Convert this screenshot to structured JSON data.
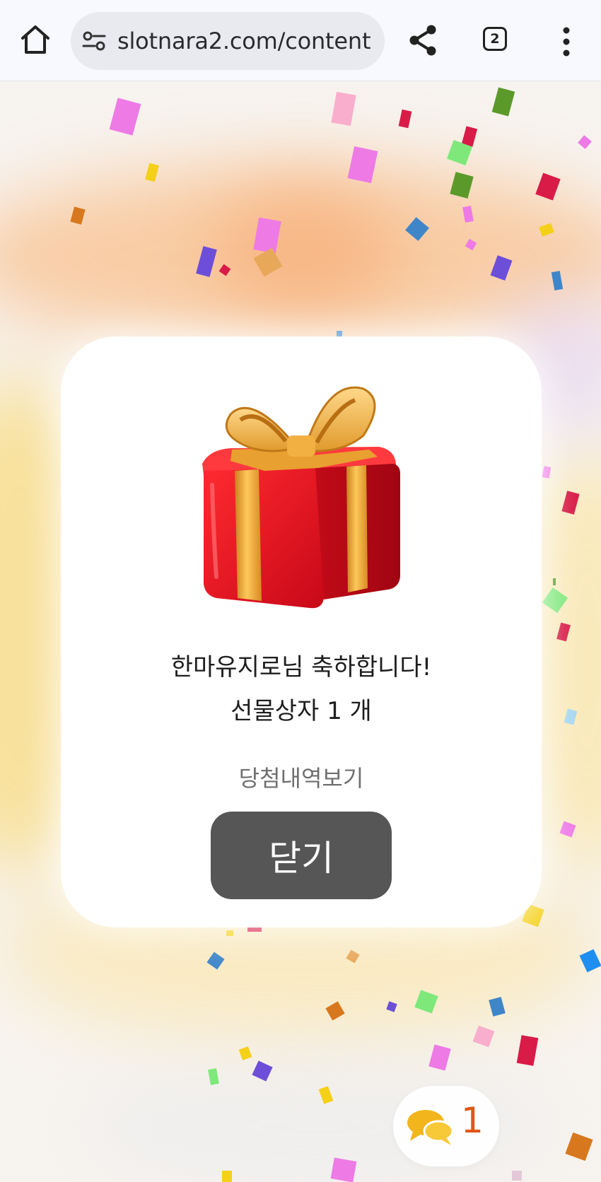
{
  "browser": {
    "url": "slotnara2.com/content",
    "tab_count": "2",
    "icons": [
      "home-icon",
      "site-info-icon",
      "share-icon",
      "tabs-icon",
      "menu-icon"
    ]
  },
  "popup": {
    "message_line1": "한마유지로님 축하합니다!",
    "message_line2": "선물상자 1 개",
    "history_link": "당첨내역보기",
    "close_button": "닫기",
    "image": "gift-box"
  },
  "chat": {
    "count": "1",
    "icon": "chat-bubbles-icon"
  },
  "colors": {
    "close_button": "#575656",
    "chat_count": "#e0561a",
    "gift_red": "#d8101f",
    "ribbon_gold": "#f0a22a"
  }
}
